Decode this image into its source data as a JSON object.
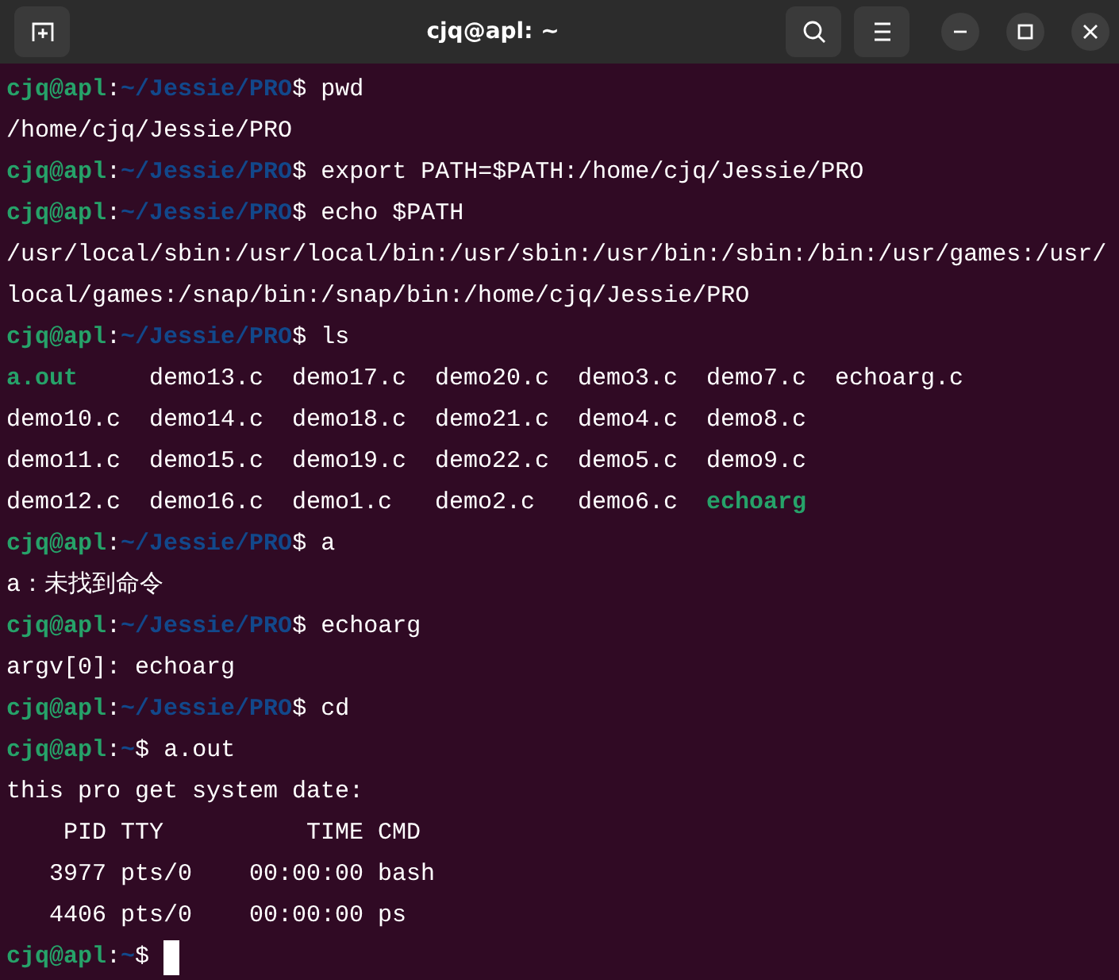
{
  "window": {
    "title": "cjq@apl: ~"
  },
  "terminal": {
    "lines": [
      {
        "kind": "prompt",
        "user_host": "cjq@apl",
        "sep": ":",
        "path": "~/Jessie/PRO",
        "sign": "$",
        "command": "pwd"
      },
      {
        "kind": "output",
        "text": "/home/cjq/Jessie/PRO"
      },
      {
        "kind": "prompt",
        "user_host": "cjq@apl",
        "sep": ":",
        "path": "~/Jessie/PRO",
        "sign": "$",
        "command": "export PATH=$PATH:/home/cjq/Jessie/PRO"
      },
      {
        "kind": "prompt",
        "user_host": "cjq@apl",
        "sep": ":",
        "path": "~/Jessie/PRO",
        "sign": "$",
        "command": "echo $PATH"
      },
      {
        "kind": "output",
        "text": "/usr/local/sbin:/usr/local/bin:/usr/sbin:/usr/bin:/sbin:/bin:/usr/games:/usr/"
      },
      {
        "kind": "output",
        "text": "local/games:/snap/bin:/snap/bin:/home/cjq/Jessie/PRO"
      },
      {
        "kind": "prompt",
        "user_host": "cjq@apl",
        "sep": ":",
        "path": "~/Jessie/PRO",
        "sign": "$",
        "command": "ls"
      },
      {
        "kind": "listing",
        "rows": [
          [
            {
              "name": "a.out",
              "kind": "executable"
            },
            {
              "name": "demo13.c",
              "kind": "file"
            },
            {
              "name": "demo17.c",
              "kind": "file"
            },
            {
              "name": "demo20.c",
              "kind": "file"
            },
            {
              "name": "demo3.c",
              "kind": "file"
            },
            {
              "name": "demo7.c",
              "kind": "file"
            },
            {
              "name": "echoarg.c",
              "kind": "file"
            }
          ],
          [
            {
              "name": "demo10.c",
              "kind": "file"
            },
            {
              "name": "demo14.c",
              "kind": "file"
            },
            {
              "name": "demo18.c",
              "kind": "file"
            },
            {
              "name": "demo21.c",
              "kind": "file"
            },
            {
              "name": "demo4.c",
              "kind": "file"
            },
            {
              "name": "demo8.c",
              "kind": "file"
            }
          ],
          [
            {
              "name": "demo11.c",
              "kind": "file"
            },
            {
              "name": "demo15.c",
              "kind": "file"
            },
            {
              "name": "demo19.c",
              "kind": "file"
            },
            {
              "name": "demo22.c",
              "kind": "file"
            },
            {
              "name": "demo5.c",
              "kind": "file"
            },
            {
              "name": "demo9.c",
              "kind": "file"
            }
          ],
          [
            {
              "name": "demo12.c",
              "kind": "file"
            },
            {
              "name": "demo16.c",
              "kind": "file"
            },
            {
              "name": "demo1.c",
              "kind": "file"
            },
            {
              "name": "demo2.c",
              "kind": "file"
            },
            {
              "name": "demo6.c",
              "kind": "file"
            },
            {
              "name": "echoarg",
              "kind": "executable"
            }
          ]
        ]
      },
      {
        "kind": "prompt",
        "user_host": "cjq@apl",
        "sep": ":",
        "path": "~/Jessie/PRO",
        "sign": "$",
        "command": "a"
      },
      {
        "kind": "output",
        "text": "a：未找到命令"
      },
      {
        "kind": "prompt",
        "user_host": "cjq@apl",
        "sep": ":",
        "path": "~/Jessie/PRO",
        "sign": "$",
        "command": "echoarg"
      },
      {
        "kind": "output",
        "text": "argv[0]: echoarg"
      },
      {
        "kind": "prompt",
        "user_host": "cjq@apl",
        "sep": ":",
        "path": "~/Jessie/PRO",
        "sign": "$",
        "command": "cd"
      },
      {
        "kind": "prompt",
        "user_host": "cjq@apl",
        "sep": ":",
        "path": "~",
        "sign": "$",
        "command": "a.out"
      },
      {
        "kind": "output",
        "text": "this pro get system date:"
      },
      {
        "kind": "table",
        "columns": [
          "PID",
          "TTY",
          "TIME",
          "CMD"
        ],
        "rows": [
          [
            "3977",
            "pts/0",
            "00:00:00",
            "bash"
          ],
          [
            "4406",
            "pts/0",
            "00:00:00",
            "ps"
          ]
        ]
      },
      {
        "kind": "prompt",
        "user_host": "cjq@apl",
        "sep": ":",
        "path": "~",
        "sign": "$",
        "cursor": true
      }
    ]
  }
}
